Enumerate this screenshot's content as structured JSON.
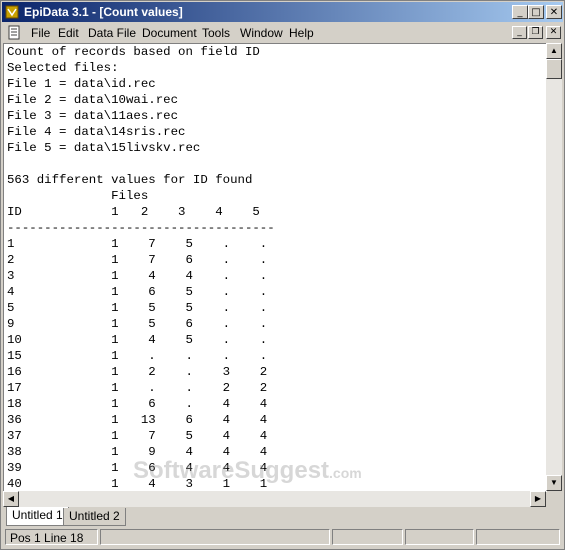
{
  "window": {
    "title": "EpiData 3.1 - [Count values]",
    "controls": {
      "minimize": "_",
      "maximize": "□",
      "close": "✕"
    }
  },
  "menu": {
    "items": [
      "File",
      "Edit",
      "Data File",
      "Document",
      "Tools",
      "Window",
      "Help"
    ],
    "child_controls": {
      "minimize": "_",
      "restore": "❐",
      "close": "✕"
    }
  },
  "document": {
    "lines": [
      "Count of records based on field ID",
      "Selected files:",
      "File 1 = data\\id.rec",
      "File 2 = data\\10wai.rec",
      "File 3 = data\\11aes.rec",
      "File 4 = data\\14sris.rec",
      "File 5 = data\\15livskv.rec",
      "",
      "563 different values for ID found",
      "              Files",
      "ID            1   2    3    4    5",
      "------------------------------------",
      "1             1    7    5    .    .",
      "2             1    7    6    .    .",
      "3             1    4    4    .    .",
      "4             1    6    5    .    .",
      "5             1    5    5    .    .",
      "9             1    5    6    .    .",
      "10            1    4    5    .    .",
      "15            1    .    .    .    .",
      "16            1    2    .    3    2",
      "17            1    .    .    2    2",
      "18            1    6    .    4    4",
      "36            1   13    6    4    4",
      "37            1    7    5    4    4",
      "38            1    9    4    4    4",
      "39            1    6    4    4    4",
      "40            1    4    3    1    1"
    ]
  },
  "scroll": {
    "up": "▲",
    "down": "▼",
    "left": "◀",
    "right": "▶"
  },
  "tabs": [
    "Untitled 1",
    "Untitled 2"
  ],
  "status": {
    "position": "Pos 1  Line 18"
  },
  "watermark": {
    "main": "SoftwareSuggest",
    "suffix": ".com"
  },
  "colors": {
    "titlebar_start": "#0a246a",
    "titlebar_end": "#a6caf0",
    "chrome": "#d4d0c8"
  }
}
